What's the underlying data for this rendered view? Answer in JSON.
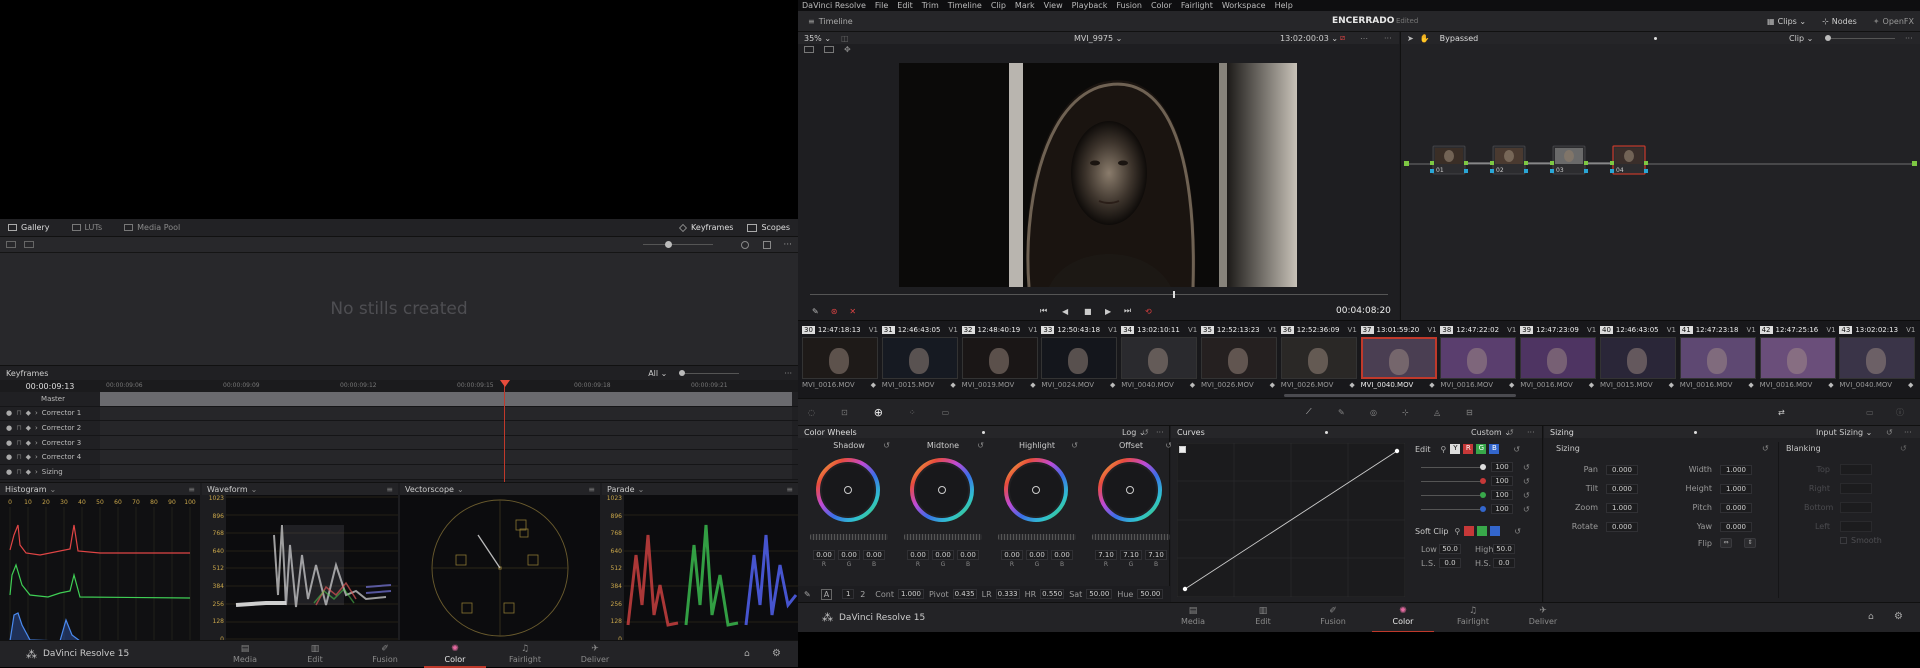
{
  "left": {
    "gallery_bar": {
      "gallery": "Gallery",
      "luts": "LUTs",
      "media_pool": "Media Pool",
      "keyframes": "Keyframes",
      "scopes": "Scopes"
    },
    "no_stills": "No stills created",
    "keyframes_panel": {
      "title": "Keyframes",
      "filter": "All",
      "timecode": "00:00:09:13",
      "ruler": [
        "00:00:09:06",
        "00:00:09:09",
        "00:00:09:12",
        "00:00:09:15",
        "00:00:09:18",
        "00:00:09:21"
      ],
      "tracks": [
        "Master",
        "Corrector 1",
        "Corrector 2",
        "Corrector 3",
        "Corrector 4",
        "Sizing"
      ]
    },
    "scopes": {
      "histogram": "Histogram",
      "histogram_ticks": [
        "0",
        "10",
        "20",
        "30",
        "40",
        "50",
        "60",
        "70",
        "80",
        "90",
        "100"
      ],
      "waveform": "Waveform",
      "vectorscope": "Vectorscope",
      "parade": "Parade",
      "levels": [
        "1023",
        "896",
        "768",
        "640",
        "512",
        "384",
        "256",
        "128",
        "0"
      ]
    },
    "footer": {
      "brand": "DaVinci Resolve 15"
    }
  },
  "menu": [
    "DaVinci Resolve",
    "File",
    "Edit",
    "Trim",
    "Timeline",
    "Clip",
    "Mark",
    "View",
    "Playback",
    "Fusion",
    "Color",
    "Fairlight",
    "Workspace",
    "Help"
  ],
  "toolbar": {
    "timeline": "Timeline",
    "project": "ENCERRADO",
    "edited": "Edited",
    "clips": "Clips",
    "nodes": "Nodes",
    "openfx": "OpenFX"
  },
  "viewer": {
    "zoom": "35%",
    "clip_name": "MVI_9975",
    "timecode": "13:02:00:03",
    "playhead_tc": "00:04:08:20"
  },
  "node_editor": {
    "status": "Bypassed",
    "mode": "Clip",
    "nodes": [
      {
        "label": "01"
      },
      {
        "label": "02"
      },
      {
        "label": "03"
      },
      {
        "label": "04"
      }
    ]
  },
  "clips": [
    {
      "num": "30",
      "tc": "12:47:18:13",
      "track": "V1",
      "name": "MVI_0016.MOV"
    },
    {
      "num": "31",
      "tc": "12:46:43:05",
      "track": "V1",
      "name": "MVI_0015.MOV"
    },
    {
      "num": "32",
      "tc": "12:48:40:19",
      "track": "V1",
      "name": "MVI_0019.MOV"
    },
    {
      "num": "33",
      "tc": "12:50:43:18",
      "track": "V1",
      "name": "MVI_0024.MOV"
    },
    {
      "num": "34",
      "tc": "13:02:10:11",
      "track": "V1",
      "name": "MVI_0040.MOV"
    },
    {
      "num": "35",
      "tc": "12:52:13:23",
      "track": "V1",
      "name": "MVI_0026.MOV"
    },
    {
      "num": "36",
      "tc": "12:52:36:09",
      "track": "V1",
      "name": "MVI_0026.MOV"
    },
    {
      "num": "37",
      "tc": "13:01:59:20",
      "track": "V1",
      "name": "MVI_0040.MOV"
    },
    {
      "num": "38",
      "tc": "12:47:22:02",
      "track": "V1",
      "name": "MVI_0016.MOV"
    },
    {
      "num": "39",
      "tc": "12:47:23:09",
      "track": "V1",
      "name": "MVI_0016.MOV"
    },
    {
      "num": "40",
      "tc": "12:46:43:05",
      "track": "V1",
      "name": "MVI_0015.MOV"
    },
    {
      "num": "41",
      "tc": "12:47:23:18",
      "track": "V1",
      "name": "MVI_0016.MOV"
    },
    {
      "num": "42",
      "tc": "12:47:25:16",
      "track": "V1",
      "name": "MVI_0016.MOV"
    },
    {
      "num": "43",
      "tc": "13:02:02:13",
      "track": "V1",
      "name": "MVI_0040.MOV"
    }
  ],
  "color_wheels": {
    "title": "Color Wheels",
    "mode": "Log",
    "wheels": [
      {
        "name": "Shadow",
        "r": "0.00",
        "g": "0.00",
        "b": "0.00"
      },
      {
        "name": "Midtone",
        "r": "0.00",
        "g": "0.00",
        "b": "0.00"
      },
      {
        "name": "Highlight",
        "r": "0.00",
        "g": "0.00",
        "b": "0.00"
      },
      {
        "name": "Offset",
        "r": "7.10",
        "g": "7.10",
        "b": "7.10"
      }
    ],
    "channel_labels": [
      "R",
      "G",
      "B"
    ],
    "bottom": {
      "p1": "1",
      "p2": "2",
      "cont_label": "Cont",
      "cont": "1.000",
      "pivot_label": "Pivot",
      "pivot": "0.435",
      "lr_label": "LR",
      "lr": "0.333",
      "hr_label": "HR",
      "hr": "0.550",
      "sat_label": "Sat",
      "sat": "50.00",
      "hue_label": "Hue",
      "hue": "50.00"
    }
  },
  "curves": {
    "title": "Curves",
    "mode": "Custom",
    "edit_label": "Edit",
    "y_btn": "Y",
    "r_btn": "R",
    "g_btn": "G",
    "b_btn": "B",
    "values": [
      "100",
      "100",
      "100",
      "100"
    ],
    "soft_clip": "Soft Clip",
    "low_label": "Low",
    "low": "50.0",
    "high_label": "High",
    "high": "50.0",
    "ls_label": "L.S.",
    "ls": "0.0",
    "hs_label": "H.S.",
    "hs": "0.0"
  },
  "sizing": {
    "title": "Sizing",
    "mode": "Input Sizing",
    "section": "Sizing",
    "left": [
      {
        "label": "Pan",
        "value": "0.000"
      },
      {
        "label": "Tilt",
        "value": "0.000"
      },
      {
        "label": "Zoom",
        "value": "1.000"
      },
      {
        "label": "Rotate",
        "value": "0.000"
      }
    ],
    "right": [
      {
        "label": "Width",
        "value": "1.000"
      },
      {
        "label": "Height",
        "value": "1.000"
      },
      {
        "label": "Pitch",
        "value": "0.000"
      },
      {
        "label": "Yaw",
        "value": "0.000"
      }
    ],
    "flip_label": "Flip",
    "blanking": "Blanking",
    "blank_fields": [
      "Top",
      "Right",
      "Bottom",
      "Left"
    ],
    "smooth": "Smooth"
  },
  "pages": [
    "Media",
    "Edit",
    "Fusion",
    "Color",
    "Fairlight",
    "Deliver"
  ],
  "active_page": "Color",
  "right_footer": {
    "brand": "DaVinci Resolve 15"
  }
}
